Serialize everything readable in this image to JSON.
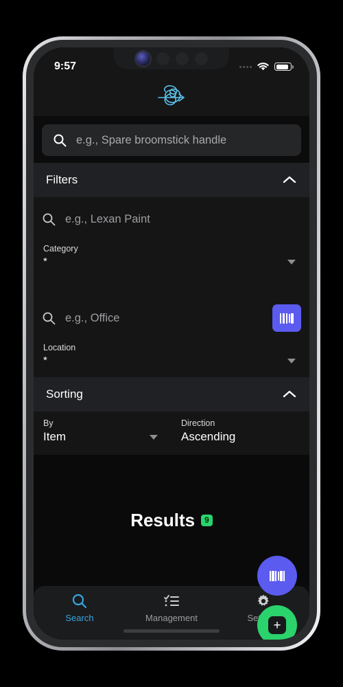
{
  "status_bar": {
    "time": "9:57",
    "wifi_icon": "wifi-icon",
    "battery_icon": "battery-icon",
    "signal_icon": "signal-dots-icon"
  },
  "app_header": {
    "logo_icon": "tangled-scribble-arrow-logo",
    "logo_color": "#5bc0e8"
  },
  "search": {
    "icon": "search-icon",
    "placeholder": "e.g., Spare broomstick handle",
    "value": ""
  },
  "filters": {
    "title": "Filters",
    "expanded": true,
    "chevron_icon": "chevron-up-icon",
    "category": {
      "search_icon": "search-icon",
      "search_placeholder": "e.g., Lexan Paint",
      "search_value": "",
      "label": "Category",
      "value": "*",
      "dropdown_icon": "caret-down-icon"
    },
    "location": {
      "search_icon": "search-icon",
      "search_placeholder": "e.g., Office",
      "search_value": "",
      "label": "Location",
      "value": "*",
      "dropdown_icon": "caret-down-icon",
      "scan_button_icon": "barcode-icon",
      "scan_button_color": "#5b5bef"
    }
  },
  "sorting": {
    "title": "Sorting",
    "expanded": true,
    "chevron_icon": "chevron-up-icon",
    "by": {
      "label": "By",
      "value": "Item",
      "dropdown_icon": "caret-down-icon"
    },
    "direction": {
      "label": "Direction",
      "value": "Ascending"
    }
  },
  "results": {
    "title": "Results",
    "count": "9",
    "badge_color": "#2ad36b"
  },
  "fabs": {
    "scan": {
      "icon": "barcode-icon",
      "color": "#5b5bef"
    },
    "add": {
      "icon": "plus-icon",
      "color": "#2ad36b"
    }
  },
  "bottom_nav": {
    "active_color": "#37a7de",
    "items": [
      {
        "label": "Search",
        "icon": "search-icon",
        "active": true
      },
      {
        "label": "Management",
        "icon": "checklist-icon",
        "active": false
      },
      {
        "label": "Settings",
        "icon": "gear-icon",
        "active": false
      }
    ]
  }
}
